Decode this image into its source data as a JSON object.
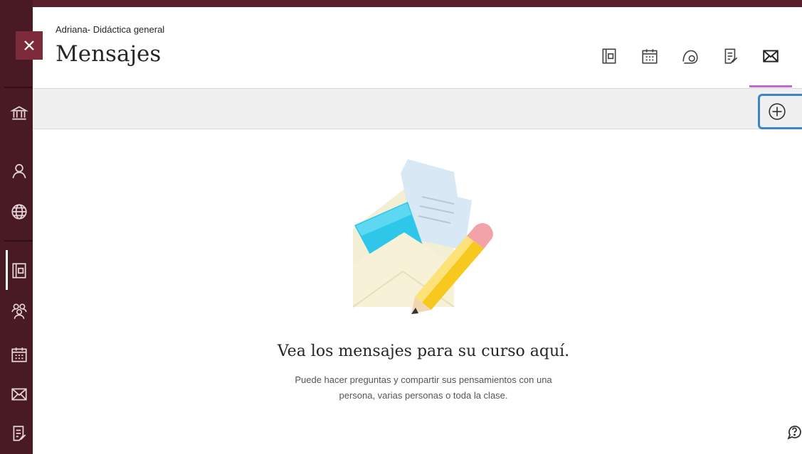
{
  "header": {
    "course_name": "Adriana- Didáctica general",
    "page_title": "Mensajes"
  },
  "close_button": {
    "icon": "close-icon"
  },
  "top_nav": {
    "icons": [
      "content-icon",
      "calendar-icon",
      "discussions-icon",
      "gradebook-icon",
      "messages-icon"
    ],
    "active": "messages-icon",
    "active_color": "#c267d6"
  },
  "toolbar": {
    "add_button": {
      "icon": "add-circle-icon",
      "highlight_color": "#3a86c8"
    }
  },
  "sidebar": {
    "icons": [
      "institution-icon",
      "profile-icon",
      "globe-icon",
      "course-content-icon",
      "groups-icon",
      "calendar-icon",
      "messages-icon",
      "grades-icon"
    ],
    "background": "#4a1a24"
  },
  "empty_state": {
    "illustration": "envelope-with-pencil",
    "heading": "Vea los mensajes para su curso aquí.",
    "description": "Puede hacer preguntas y compartir sus pensamientos con una persona, varias personas o toda la clase."
  },
  "help": {
    "icon": "help-icon"
  }
}
